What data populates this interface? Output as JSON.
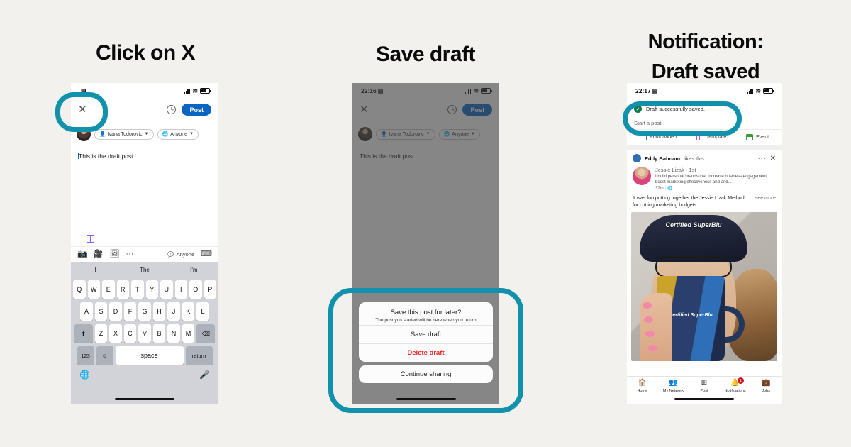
{
  "theme": {
    "background": "#f2f1ed",
    "highlight": "#1191ac",
    "brand_blue": "#0a66c2",
    "danger_red": "#f01c1c",
    "success_green": "#0a7a4a"
  },
  "steps": {
    "left_title": "Click on X",
    "mid_title": "Save draft",
    "right_title_line1": "Notification:",
    "right_title_line2": "Draft saved"
  },
  "left_phone": {
    "status": {
      "time": "",
      "lock_icon": "lock-icon",
      "signal_icon": "signal-bars-icon",
      "wifi_icon": "wifi-icon",
      "battery_icon": "battery-icon"
    },
    "composer": {
      "close_label": "✕",
      "clock_icon": "clock-icon",
      "post_label": "Post",
      "author_name": "Ivana Todorovic",
      "audience": "Anyone",
      "draft_text": "This is the draft post",
      "template_icon": "template-icon",
      "tools": [
        "camera-icon",
        "video-icon",
        "image-icon",
        "more-icon"
      ],
      "comment_scope": "Anyone",
      "keyboard_icon": "keyboard-icon"
    },
    "keyboard": {
      "predictions": [
        "I",
        "The",
        "I'm"
      ],
      "row1": [
        "Q",
        "W",
        "E",
        "R",
        "T",
        "Y",
        "U",
        "I",
        "O",
        "P"
      ],
      "row2": [
        "A",
        "S",
        "D",
        "F",
        "G",
        "H",
        "J",
        "K",
        "L"
      ],
      "row3": [
        "Z",
        "X",
        "C",
        "V",
        "B",
        "N",
        "M"
      ],
      "shift_label": "⬆",
      "backspace_label": "⌫",
      "numbers_label": "123",
      "emoji_label": "☺",
      "space_label": "space",
      "return_label": "return",
      "globe_label": "🌐",
      "mic_label": "🎤"
    }
  },
  "mid_phone": {
    "status": {
      "time": "22:16"
    },
    "composer": {
      "close_label": "✕",
      "post_label": "Post",
      "author_name": "Ivana Todorovic",
      "audience": "Anyone",
      "draft_text": "This is the draft post"
    },
    "sheet": {
      "title": "Save this post for later?",
      "subtitle": "The post you started will be here when you return",
      "save_label": "Save draft",
      "delete_label": "Delete draft",
      "continue_label": "Continue sharing"
    }
  },
  "right_phone": {
    "status": {
      "time": "22:17"
    },
    "toast": {
      "message": "Draft successfully saved.",
      "icon": "check-circle-icon"
    },
    "start_post_placeholder": "Start a post",
    "share_options": [
      {
        "label": "Photo/Video",
        "icon": "photo-icon"
      },
      {
        "label": "Template",
        "icon": "template-icon"
      },
      {
        "label": "Event",
        "icon": "calendar-icon"
      }
    ],
    "feed_post": {
      "social_proof_name": "Eddy Bahnam",
      "social_proof_suffix": "likes this",
      "more_icon": "more-dots-icon",
      "close_icon": "close-icon",
      "author": "Jessie Lizak",
      "degree": "· 1st",
      "headline": "I build personal brands that increase business engagement, boost marketing effectiveness and and...",
      "time": "37m ·",
      "globe_icon": "globe-icon",
      "body": "It was fun putting together the Jessie Lizak Method for cutting marketing budgets",
      "see_more": "...see more",
      "image_cap_text": "Certified SuperBlu",
      "image_mug_text": "Certified SuperBlu"
    },
    "navbar": [
      {
        "label": "Home",
        "icon": "home-icon",
        "badge": ""
      },
      {
        "label": "My Network",
        "icon": "network-icon",
        "badge": ""
      },
      {
        "label": "Post",
        "icon": "plus-box-icon",
        "badge": ""
      },
      {
        "label": "Notifications",
        "icon": "bell-icon",
        "badge": "1"
      },
      {
        "label": "Jobs",
        "icon": "briefcase-icon",
        "badge": ""
      }
    ]
  }
}
